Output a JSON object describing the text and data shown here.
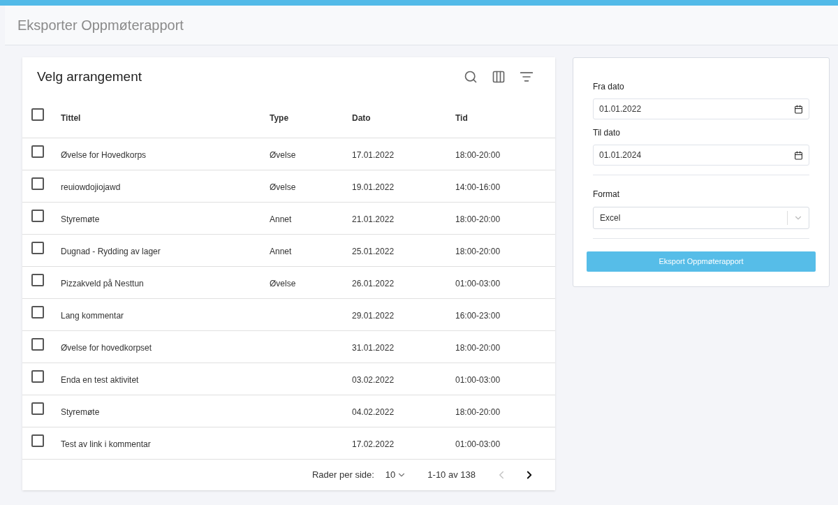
{
  "page": {
    "title": "Eksporter Oppmøterapport"
  },
  "table": {
    "title": "Velg arrangement",
    "select_all": {
      "checked": false
    },
    "columns": [
      "Tittel",
      "Type",
      "Dato",
      "Tid"
    ],
    "rows": [
      {
        "checked": false,
        "cells": [
          "Øvelse for Hovedkorps",
          "Øvelse",
          "17.01.2022",
          "18:00-20:00"
        ]
      },
      {
        "checked": false,
        "cells": [
          "reuiowdojiojawd",
          "Øvelse",
          "19.01.2022",
          "14:00-16:00"
        ]
      },
      {
        "checked": false,
        "cells": [
          "Styremøte",
          "Annet",
          "21.01.2022",
          "18:00-20:00"
        ]
      },
      {
        "checked": false,
        "cells": [
          "Dugnad - Rydding av lager",
          "Annet",
          "25.01.2022",
          "18:00-20:00"
        ]
      },
      {
        "checked": false,
        "cells": [
          "Pizzakveld på Nesttun",
          "Øvelse",
          "26.01.2022",
          "01:00-03:00"
        ]
      },
      {
        "checked": false,
        "cells": [
          "Lang kommentar",
          "",
          "29.01.2022",
          "16:00-23:00"
        ]
      },
      {
        "checked": false,
        "cells": [
          "Øvelse for hovedkorpset",
          "",
          "31.01.2022",
          "18:00-20:00"
        ]
      },
      {
        "checked": false,
        "cells": [
          "Enda en test aktivitet",
          "",
          "03.02.2022",
          "01:00-03:00"
        ]
      },
      {
        "checked": false,
        "cells": [
          "Styremøte",
          "",
          "04.02.2022",
          "18:00-20:00"
        ]
      },
      {
        "checked": false,
        "cells": [
          "Test av link i kommentar",
          "",
          "17.02.2022",
          "01:00-03:00"
        ]
      }
    ],
    "pagination": {
      "rows_per_page_label": "Rader per side:",
      "rows_per_page": "10",
      "range": "1-10 av 138",
      "prev_disabled": true,
      "next_disabled": false
    }
  },
  "export_form": {
    "from_label": "Fra dato",
    "from_value": "01.01.2022",
    "to_label": "Til dato",
    "to_value": "01.01.2024",
    "format_label": "Format",
    "format_value": "Excel",
    "button": "Eksport Oppmøterapport"
  }
}
